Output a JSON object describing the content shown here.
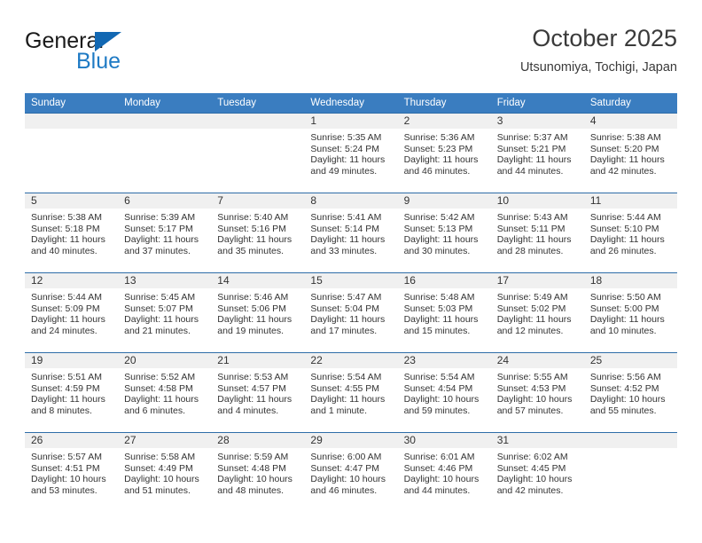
{
  "logo": {
    "word_top": "General",
    "word_bottom": "Blue",
    "triangle_color": "#1268b3",
    "blue_color": "#1e7ac4"
  },
  "header": {
    "title": "October 2025",
    "subtitle": "Utsunomiya, Tochigi, Japan"
  },
  "theme": {
    "header_band": "#3a7dc0",
    "row_divider": "#2e6da8",
    "daynum_band": "#f0f0f0",
    "text": "#333333"
  },
  "calendar": {
    "weekday_headers": [
      "Sunday",
      "Monday",
      "Tuesday",
      "Wednesday",
      "Thursday",
      "Friday",
      "Saturday"
    ],
    "labels": {
      "sunrise": "Sunrise:",
      "sunset": "Sunset:",
      "daylight": "Daylight:"
    },
    "weeks": [
      [
        {
          "day": "",
          "sunrise": "",
          "sunset": "",
          "daylight": ""
        },
        {
          "day": "",
          "sunrise": "",
          "sunset": "",
          "daylight": ""
        },
        {
          "day": "",
          "sunrise": "",
          "sunset": "",
          "daylight": ""
        },
        {
          "day": "1",
          "sunrise": "Sunrise: 5:35 AM",
          "sunset": "Sunset: 5:24 PM",
          "daylight": "Daylight: 11 hours and 49 minutes."
        },
        {
          "day": "2",
          "sunrise": "Sunrise: 5:36 AM",
          "sunset": "Sunset: 5:23 PM",
          "daylight": "Daylight: 11 hours and 46 minutes."
        },
        {
          "day": "3",
          "sunrise": "Sunrise: 5:37 AM",
          "sunset": "Sunset: 5:21 PM",
          "daylight": "Daylight: 11 hours and 44 minutes."
        },
        {
          "day": "4",
          "sunrise": "Sunrise: 5:38 AM",
          "sunset": "Sunset: 5:20 PM",
          "daylight": "Daylight: 11 hours and 42 minutes."
        }
      ],
      [
        {
          "day": "5",
          "sunrise": "Sunrise: 5:38 AM",
          "sunset": "Sunset: 5:18 PM",
          "daylight": "Daylight: 11 hours and 40 minutes."
        },
        {
          "day": "6",
          "sunrise": "Sunrise: 5:39 AM",
          "sunset": "Sunset: 5:17 PM",
          "daylight": "Daylight: 11 hours and 37 minutes."
        },
        {
          "day": "7",
          "sunrise": "Sunrise: 5:40 AM",
          "sunset": "Sunset: 5:16 PM",
          "daylight": "Daylight: 11 hours and 35 minutes."
        },
        {
          "day": "8",
          "sunrise": "Sunrise: 5:41 AM",
          "sunset": "Sunset: 5:14 PM",
          "daylight": "Daylight: 11 hours and 33 minutes."
        },
        {
          "day": "9",
          "sunrise": "Sunrise: 5:42 AM",
          "sunset": "Sunset: 5:13 PM",
          "daylight": "Daylight: 11 hours and 30 minutes."
        },
        {
          "day": "10",
          "sunrise": "Sunrise: 5:43 AM",
          "sunset": "Sunset: 5:11 PM",
          "daylight": "Daylight: 11 hours and 28 minutes."
        },
        {
          "day": "11",
          "sunrise": "Sunrise: 5:44 AM",
          "sunset": "Sunset: 5:10 PM",
          "daylight": "Daylight: 11 hours and 26 minutes."
        }
      ],
      [
        {
          "day": "12",
          "sunrise": "Sunrise: 5:44 AM",
          "sunset": "Sunset: 5:09 PM",
          "daylight": "Daylight: 11 hours and 24 minutes."
        },
        {
          "day": "13",
          "sunrise": "Sunrise: 5:45 AM",
          "sunset": "Sunset: 5:07 PM",
          "daylight": "Daylight: 11 hours and 21 minutes."
        },
        {
          "day": "14",
          "sunrise": "Sunrise: 5:46 AM",
          "sunset": "Sunset: 5:06 PM",
          "daylight": "Daylight: 11 hours and 19 minutes."
        },
        {
          "day": "15",
          "sunrise": "Sunrise: 5:47 AM",
          "sunset": "Sunset: 5:04 PM",
          "daylight": "Daylight: 11 hours and 17 minutes."
        },
        {
          "day": "16",
          "sunrise": "Sunrise: 5:48 AM",
          "sunset": "Sunset: 5:03 PM",
          "daylight": "Daylight: 11 hours and 15 minutes."
        },
        {
          "day": "17",
          "sunrise": "Sunrise: 5:49 AM",
          "sunset": "Sunset: 5:02 PM",
          "daylight": "Daylight: 11 hours and 12 minutes."
        },
        {
          "day": "18",
          "sunrise": "Sunrise: 5:50 AM",
          "sunset": "Sunset: 5:00 PM",
          "daylight": "Daylight: 11 hours and 10 minutes."
        }
      ],
      [
        {
          "day": "19",
          "sunrise": "Sunrise: 5:51 AM",
          "sunset": "Sunset: 4:59 PM",
          "daylight": "Daylight: 11 hours and 8 minutes."
        },
        {
          "day": "20",
          "sunrise": "Sunrise: 5:52 AM",
          "sunset": "Sunset: 4:58 PM",
          "daylight": "Daylight: 11 hours and 6 minutes."
        },
        {
          "day": "21",
          "sunrise": "Sunrise: 5:53 AM",
          "sunset": "Sunset: 4:57 PM",
          "daylight": "Daylight: 11 hours and 4 minutes."
        },
        {
          "day": "22",
          "sunrise": "Sunrise: 5:54 AM",
          "sunset": "Sunset: 4:55 PM",
          "daylight": "Daylight: 11 hours and 1 minute."
        },
        {
          "day": "23",
          "sunrise": "Sunrise: 5:54 AM",
          "sunset": "Sunset: 4:54 PM",
          "daylight": "Daylight: 10 hours and 59 minutes."
        },
        {
          "day": "24",
          "sunrise": "Sunrise: 5:55 AM",
          "sunset": "Sunset: 4:53 PM",
          "daylight": "Daylight: 10 hours and 57 minutes."
        },
        {
          "day": "25",
          "sunrise": "Sunrise: 5:56 AM",
          "sunset": "Sunset: 4:52 PM",
          "daylight": "Daylight: 10 hours and 55 minutes."
        }
      ],
      [
        {
          "day": "26",
          "sunrise": "Sunrise: 5:57 AM",
          "sunset": "Sunset: 4:51 PM",
          "daylight": "Daylight: 10 hours and 53 minutes."
        },
        {
          "day": "27",
          "sunrise": "Sunrise: 5:58 AM",
          "sunset": "Sunset: 4:49 PM",
          "daylight": "Daylight: 10 hours and 51 minutes."
        },
        {
          "day": "28",
          "sunrise": "Sunrise: 5:59 AM",
          "sunset": "Sunset: 4:48 PM",
          "daylight": "Daylight: 10 hours and 48 minutes."
        },
        {
          "day": "29",
          "sunrise": "Sunrise: 6:00 AM",
          "sunset": "Sunset: 4:47 PM",
          "daylight": "Daylight: 10 hours and 46 minutes."
        },
        {
          "day": "30",
          "sunrise": "Sunrise: 6:01 AM",
          "sunset": "Sunset: 4:46 PM",
          "daylight": "Daylight: 10 hours and 44 minutes."
        },
        {
          "day": "31",
          "sunrise": "Sunrise: 6:02 AM",
          "sunset": "Sunset: 4:45 PM",
          "daylight": "Daylight: 10 hours and 42 minutes."
        },
        {
          "day": "",
          "sunrise": "",
          "sunset": "",
          "daylight": ""
        }
      ]
    ]
  }
}
